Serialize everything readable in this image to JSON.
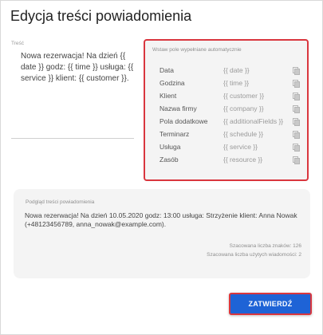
{
  "dialog": {
    "title": "Edycja treści powiadomienia"
  },
  "editor": {
    "label": "Treść",
    "text": "Nowa rezerwacja! Na dzień {{ date }} godz: {{ time }} usługa: {{ service }} klient: {{ customer }}."
  },
  "fields": {
    "header": "Wstaw pole wypełniane automatycznie",
    "items": [
      {
        "name": "Data",
        "token": "{{ date }}"
      },
      {
        "name": "Godzina",
        "token": "{{ time }}"
      },
      {
        "name": "Klient",
        "token": "{{ customer }}"
      },
      {
        "name": "Nazwa firmy",
        "token": "{{ company }}"
      },
      {
        "name": "Pola dodatkowe",
        "token": "{{ additionalFields }}"
      },
      {
        "name": "Terminarz",
        "token": "{{ schedule }}"
      },
      {
        "name": "Usługa",
        "token": "{{ service }}"
      },
      {
        "name": "Zasób",
        "token": "{{ resource }}"
      }
    ]
  },
  "preview": {
    "header": "Podgląd treści powiadomienia",
    "text": "Nowa rezerwacja! Na dzień 10.05.2020 godz: 13:00 usługa: Strzyżenie klient: Anna Nowak (+48123456789, anna_nowak@example.com).",
    "char_count": "Szacowana liczba znaków: 126",
    "message_count": "Szacowana liczba użytych wiadomości: 2"
  },
  "actions": {
    "confirm_label": "ZATWIERDŹ"
  },
  "colors": {
    "accent": "#1e63d6",
    "highlight_border": "#d9363e"
  }
}
